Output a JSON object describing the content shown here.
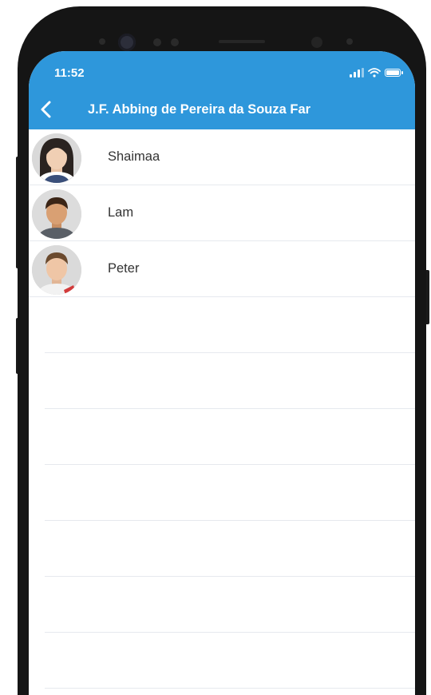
{
  "status_bar": {
    "time": "11:52",
    "icons": [
      "signal-icon",
      "wifi-icon",
      "battery-icon"
    ]
  },
  "header": {
    "title": "J.F. Abbing de Pereira da Souza Far",
    "back_icon": "chevron-left-icon",
    "color": "#2e97db"
  },
  "contacts": [
    {
      "name": "Shaimaa"
    },
    {
      "name": "Lam"
    },
    {
      "name": "Peter"
    }
  ]
}
